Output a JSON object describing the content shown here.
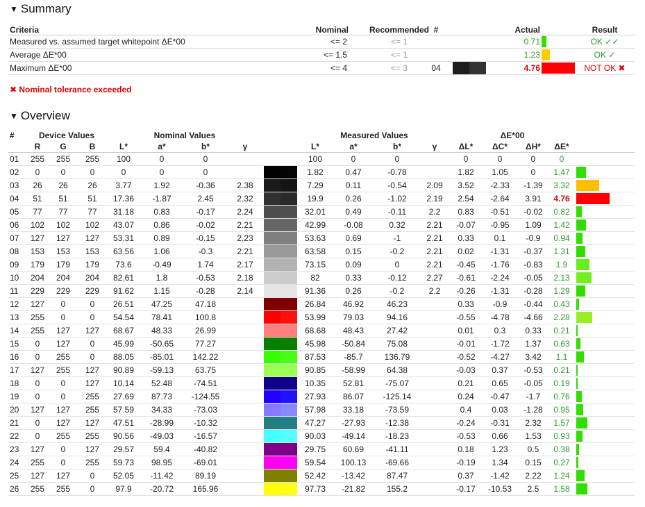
{
  "summary": {
    "title": "Summary",
    "headers": {
      "criteria": "Criteria",
      "nominal": "Nominal",
      "recommended": "Recommended",
      "num": "#",
      "actual": "Actual",
      "result": "Result"
    },
    "rows": [
      {
        "criteria": "Measured vs. assumed target whitepoint ΔE*00",
        "nominal": "<= 2",
        "recommended": "<= 1",
        "num": "",
        "actual": "0.71",
        "bar_color": "#33dd00",
        "bar_fraction": 0.14,
        "result": "OK",
        "result_icon": "✓✓",
        "status": "ok"
      },
      {
        "criteria": "Average ΔE*00",
        "nominal": "<= 1.5",
        "recommended": "<= 1",
        "num": "",
        "actual": "1.23",
        "bar_color": "#ffcc00",
        "bar_fraction": 0.24,
        "result": "OK",
        "result_icon": "✓",
        "status": "ok"
      },
      {
        "criteria": "Maximum ΔE*00",
        "nominal": "<= 4",
        "recommended": "<= 3",
        "num": "04",
        "actual": "4.76",
        "bar_color": "#ff0000",
        "bar_fraction": 1.0,
        "result": "NOT OK",
        "result_icon": "✖",
        "status": "bad",
        "swatch": [
          "#1e1e1e",
          "#333333"
        ]
      }
    ],
    "warning": "✖ Nominal tolerance exceeded"
  },
  "overview": {
    "title": "Overview",
    "group_headers": {
      "num": "#",
      "device": "Device Values",
      "nominal": "Nominal Values",
      "measured": "Measured Values",
      "delta": "ΔE*00"
    },
    "sub_headers": {
      "r": "R",
      "g": "G",
      "b": "B",
      "l": "L*",
      "a": "a*",
      "bb": "b*",
      "gamma": "γ",
      "ml": "L*",
      "ma": "a*",
      "mb": "b*",
      "mgamma": "γ",
      "dl": "ΔL*",
      "dc": "ΔC*",
      "dh": "ΔH*",
      "de": "ΔE*"
    },
    "rows": [
      {
        "n": "01",
        "r": "255",
        "g": "255",
        "b": "255",
        "L": "100",
        "a": "0",
        "bv": "0",
        "gamma": "",
        "mL": "100",
        "ma": "0",
        "mb": "0",
        "mg": "",
        "dL": "0",
        "dC": "0",
        "dH": "0",
        "dE": "0",
        "bar": 0,
        "bar_color": "#33dd00",
        "sw": [
          "#ffffff",
          "#ffffff"
        ]
      },
      {
        "n": "02",
        "r": "0",
        "g": "0",
        "b": "0",
        "L": "0",
        "a": "0",
        "bv": "0",
        "gamma": "",
        "mL": "1.82",
        "ma": "0.47",
        "mb": "-0.78",
        "mg": "",
        "dL": "1.82",
        "dC": "1.05",
        "dH": "0",
        "dE": "1.47",
        "bar": 0.29,
        "bar_color": "#33dd00",
        "sw": [
          "#000000",
          "#050505"
        ]
      },
      {
        "n": "03",
        "r": "26",
        "g": "26",
        "b": "26",
        "L": "3.77",
        "a": "1.92",
        "bv": "-0.36",
        "gamma": "2.38",
        "mL": "7.29",
        "ma": "0.11",
        "mb": "-0.54",
        "mg": "2.09",
        "dL": "3.52",
        "dC": "-2.33",
        "dH": "-1.39",
        "dE": "3.32",
        "bar": 0.68,
        "bar_color": "#ffc000",
        "sw": [
          "#1a1a1a",
          "#141414"
        ]
      },
      {
        "n": "04",
        "r": "51",
        "g": "51",
        "b": "51",
        "L": "17.36",
        "a": "-1.87",
        "bv": "2.45",
        "gamma": "2.32",
        "mL": "19.9",
        "ma": "0.26",
        "mb": "-1.02",
        "mg": "2.19",
        "dL": "2.54",
        "dC": "-2.64",
        "dH": "3.91",
        "dE": "4.76",
        "bar": 1.0,
        "bar_color": "#ff0000",
        "sw": [
          "#303030",
          "#2a2a2a"
        ],
        "bad": true
      },
      {
        "n": "05",
        "r": "77",
        "g": "77",
        "b": "77",
        "L": "31.18",
        "a": "0.83",
        "bv": "-0.17",
        "gamma": "2.24",
        "mL": "32.01",
        "ma": "0.49",
        "mb": "-0.11",
        "mg": "2.2",
        "dL": "0.83",
        "dC": "-0.51",
        "dH": "-0.02",
        "dE": "0.82",
        "bar": 0.17,
        "bar_color": "#33dd00",
        "sw": [
          "#4d4d4d",
          "#4f4f4f"
        ]
      },
      {
        "n": "06",
        "r": "102",
        "g": "102",
        "b": "102",
        "L": "43.07",
        "a": "0.86",
        "bv": "-0.02",
        "gamma": "2.21",
        "mL": "42.99",
        "ma": "-0.08",
        "mb": "0.32",
        "mg": "2.21",
        "dL": "-0.07",
        "dC": "-0.95",
        "dH": "1.09",
        "dE": "1.42",
        "bar": 0.29,
        "bar_color": "#33dd00",
        "sw": [
          "#666666",
          "#666666"
        ]
      },
      {
        "n": "07",
        "r": "127",
        "g": "127",
        "b": "127",
        "L": "53.31",
        "a": "0.89",
        "bv": "-0.15",
        "gamma": "2.23",
        "mL": "53.63",
        "ma": "0.69",
        "mb": "-1",
        "mg": "2.21",
        "dL": "0.33",
        "dC": "0.1",
        "dH": "-0.9",
        "dE": "0.94",
        "bar": 0.19,
        "bar_color": "#33dd00",
        "sw": [
          "#7f7f7f",
          "#808080"
        ]
      },
      {
        "n": "08",
        "r": "153",
        "g": "153",
        "b": "153",
        "L": "63.56",
        "a": "1.06",
        "bv": "-0.3",
        "gamma": "2.21",
        "mL": "63.58",
        "ma": "0.15",
        "mb": "-0.2",
        "mg": "2.21",
        "dL": "0.02",
        "dC": "-1.31",
        "dH": "-0.37",
        "dE": "1.31",
        "bar": 0.27,
        "bar_color": "#33dd00",
        "sw": [
          "#999999",
          "#999999"
        ]
      },
      {
        "n": "09",
        "r": "179",
        "g": "179",
        "b": "179",
        "L": "73.6",
        "a": "-0.49",
        "bv": "1.74",
        "gamma": "2.17",
        "mL": "73.15",
        "ma": "0.09",
        "mb": "0",
        "mg": "2.21",
        "dL": "-0.45",
        "dC": "-1.76",
        "dH": "-0.83",
        "dE": "1.9",
        "bar": 0.4,
        "bar_color": "#66ee22",
        "sw": [
          "#b3b3b3",
          "#b2b3b3"
        ]
      },
      {
        "n": "10",
        "r": "204",
        "g": "204",
        "b": "204",
        "L": "82.61",
        "a": "1.8",
        "bv": "-0.53",
        "gamma": "2.18",
        "mL": "82",
        "ma": "0.33",
        "mb": "-0.12",
        "mg": "2.27",
        "dL": "-0.61",
        "dC": "-2.24",
        "dH": "-0.05",
        "dE": "2.13",
        "bar": 0.45,
        "bar_color": "#77ee22",
        "sw": [
          "#cccccc",
          "#cbcbcb"
        ]
      },
      {
        "n": "11",
        "r": "229",
        "g": "229",
        "b": "229",
        "L": "91.62",
        "a": "1.15",
        "bv": "-0.28",
        "gamma": "2.14",
        "mL": "91.36",
        "ma": "0.26",
        "mb": "-0.2",
        "mg": "2.2",
        "dL": "-0.26",
        "dC": "-1.31",
        "dH": "-0.28",
        "dE": "1.29",
        "bar": 0.27,
        "bar_color": "#33dd00",
        "sw": [
          "#e5e5e5",
          "#e4e4e4"
        ]
      },
      {
        "n": "12",
        "r": "127",
        "g": "0",
        "b": "0",
        "L": "26.51",
        "a": "47.25",
        "bv": "47.18",
        "gamma": "",
        "mL": "26.84",
        "ma": "46.92",
        "mb": "46.23",
        "mg": "",
        "dL": "0.33",
        "dC": "-0.9",
        "dH": "-0.44",
        "dE": "0.43",
        "bar": 0.09,
        "bar_color": "#33dd00",
        "sw": [
          "#7f0000",
          "#800000"
        ]
      },
      {
        "n": "13",
        "r": "255",
        "g": "0",
        "b": "0",
        "L": "54.54",
        "a": "78.41",
        "bv": "100.8",
        "gamma": "",
        "mL": "53.99",
        "ma": "79.03",
        "mb": "94.16",
        "mg": "",
        "dL": "-0.55",
        "dC": "-4.78",
        "dH": "-4.66",
        "dE": "2.28",
        "bar": 0.48,
        "bar_color": "#99ee22",
        "sw": [
          "#ff0000",
          "#ff1010"
        ]
      },
      {
        "n": "14",
        "r": "255",
        "g": "127",
        "b": "127",
        "L": "68.67",
        "a": "48.33",
        "bv": "26.99",
        "gamma": "",
        "mL": "68.68",
        "ma": "48.43",
        "mb": "27.42",
        "mg": "",
        "dL": "0.01",
        "dC": "0.3",
        "dH": "0.33",
        "dE": "0.21",
        "bar": 0.04,
        "bar_color": "#33dd00",
        "sw": [
          "#ff7f7f",
          "#ff7f7e"
        ]
      },
      {
        "n": "15",
        "r": "0",
        "g": "127",
        "b": "0",
        "L": "45.99",
        "a": "-50.65",
        "bv": "77.27",
        "gamma": "",
        "mL": "45.98",
        "ma": "-50.84",
        "mb": "75.08",
        "mg": "",
        "dL": "-0.01",
        "dC": "-1.72",
        "dH": "1.37",
        "dE": "0.63",
        "bar": 0.13,
        "bar_color": "#33dd00",
        "sw": [
          "#007f00",
          "#0a7f00"
        ]
      },
      {
        "n": "16",
        "r": "0",
        "g": "255",
        "b": "0",
        "L": "88.05",
        "a": "-85.01",
        "bv": "142.22",
        "gamma": "",
        "mL": "87.53",
        "ma": "-85.7",
        "mb": "136.79",
        "mg": "",
        "dL": "-0.52",
        "dC": "-4.27",
        "dH": "3.42",
        "dE": "1.1",
        "bar": 0.23,
        "bar_color": "#33dd00",
        "sw": [
          "#33ff00",
          "#44ff11"
        ]
      },
      {
        "n": "17",
        "r": "127",
        "g": "255",
        "b": "127",
        "L": "90.89",
        "a": "-59.13",
        "bv": "63.75",
        "gamma": "",
        "mL": "90.85",
        "ma": "-58.99",
        "mb": "64.38",
        "mg": "",
        "dL": "-0.03",
        "dC": "0.37",
        "dH": "-0.53",
        "dE": "0.21",
        "bar": 0.04,
        "bar_color": "#33dd00",
        "sw": [
          "#99ff55",
          "#99ff55"
        ]
      },
      {
        "n": "18",
        "r": "0",
        "g": "0",
        "b": "127",
        "L": "10.14",
        "a": "52.48",
        "bv": "-74.51",
        "gamma": "",
        "mL": "10.35",
        "ma": "52.81",
        "mb": "-75.07",
        "mg": "",
        "dL": "0.21",
        "dC": "0.65",
        "dH": "-0.05",
        "dE": "0.19",
        "bar": 0.04,
        "bar_color": "#33dd00",
        "sw": [
          "#110088",
          "#110088"
        ]
      },
      {
        "n": "19",
        "r": "0",
        "g": "0",
        "b": "255",
        "L": "27.69",
        "a": "87.73",
        "bv": "-124.55",
        "gamma": "",
        "mL": "27.93",
        "ma": "86.07",
        "mb": "-125.14",
        "mg": "",
        "dL": "0.24",
        "dC": "-0.47",
        "dH": "-1.7",
        "dE": "0.76",
        "bar": 0.16,
        "bar_color": "#33dd00",
        "sw": [
          "#2200ff",
          "#2211ff"
        ]
      },
      {
        "n": "20",
        "r": "127",
        "g": "127",
        "b": "255",
        "L": "57.59",
        "a": "34.33",
        "bv": "-73.03",
        "gamma": "",
        "mL": "57.98",
        "ma": "33.18",
        "mb": "-73.59",
        "mg": "",
        "dL": "0.4",
        "dC": "0.03",
        "dH": "-1.28",
        "dE": "0.95",
        "bar": 0.2,
        "bar_color": "#33dd00",
        "sw": [
          "#8877ff",
          "#8888ff"
        ]
      },
      {
        "n": "21",
        "r": "0",
        "g": "127",
        "b": "127",
        "L": "47.51",
        "a": "-28.99",
        "bv": "-10.32",
        "gamma": "",
        "mL": "47.27",
        "ma": "-27.93",
        "mb": "-12.38",
        "mg": "",
        "dL": "-0.24",
        "dC": "-0.31",
        "dH": "2.32",
        "dE": "1.57",
        "bar": 0.33,
        "bar_color": "#33dd00",
        "sw": [
          "#227f80",
          "#237f88"
        ]
      },
      {
        "n": "22",
        "r": "0",
        "g": "255",
        "b": "255",
        "L": "90.56",
        "a": "-49.03",
        "bv": "-16.57",
        "gamma": "",
        "mL": "90.03",
        "ma": "-49.14",
        "mb": "-18.23",
        "mg": "",
        "dL": "-0.53",
        "dC": "0.66",
        "dH": "1.53",
        "dE": "0.93",
        "bar": 0.19,
        "bar_color": "#33dd00",
        "sw": [
          "#44ffff",
          "#55ffff"
        ]
      },
      {
        "n": "23",
        "r": "127",
        "g": "0",
        "b": "127",
        "L": "29.57",
        "a": "59.4",
        "bv": "-40.82",
        "gamma": "",
        "mL": "29.75",
        "ma": "60.69",
        "mb": "-41.11",
        "mg": "",
        "dL": "0.18",
        "dC": "1.23",
        "dH": "0.5",
        "dE": "0.38",
        "bar": 0.08,
        "bar_color": "#33dd00",
        "sw": [
          "#7f0088",
          "#7f0088"
        ]
      },
      {
        "n": "24",
        "r": "255",
        "g": "0",
        "b": "255",
        "L": "59.73",
        "a": "98.95",
        "bv": "-69.01",
        "gamma": "",
        "mL": "59.54",
        "ma": "100.13",
        "mb": "-69.66",
        "mg": "",
        "dL": "-0.19",
        "dC": "1.34",
        "dH": "0.15",
        "dE": "0.27",
        "bar": 0.06,
        "bar_color": "#33dd00",
        "sw": [
          "#ff00ee",
          "#ff00ff"
        ]
      },
      {
        "n": "25",
        "r": "127",
        "g": "127",
        "b": "0",
        "L": "52.05",
        "a": "-11.42",
        "bv": "89.19",
        "gamma": "",
        "mL": "52.42",
        "ma": "-13.42",
        "mb": "87.47",
        "mg": "",
        "dL": "0.37",
        "dC": "-1.42",
        "dH": "2.22",
        "dE": "1.24",
        "bar": 0.26,
        "bar_color": "#33dd00",
        "sw": [
          "#808000",
          "#7f8000"
        ]
      },
      {
        "n": "26",
        "r": "255",
        "g": "255",
        "b": "0",
        "L": "97.9",
        "a": "-20.72",
        "bv": "165.96",
        "gamma": "",
        "mL": "97.73",
        "ma": "-21.82",
        "mb": "155.2",
        "mg": "",
        "dL": "-0.17",
        "dC": "-10.53",
        "dH": "2.5",
        "dE": "1.58",
        "bar": 0.33,
        "bar_color": "#33dd00",
        "sw": [
          "#ffff00",
          "#ffff11"
        ]
      }
    ]
  }
}
